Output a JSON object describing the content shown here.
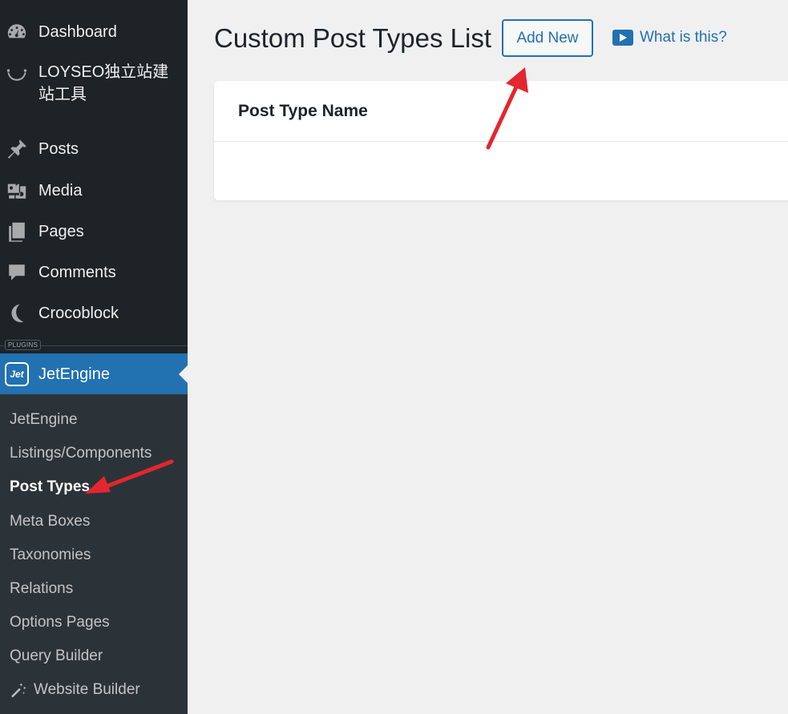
{
  "sidebar": {
    "menu": [
      {
        "label": "Dashboard",
        "icon": "dashboard-icon"
      },
      {
        "label": "LOYSEO独立站建站工具",
        "icon": "smile-icon"
      },
      {
        "label": "Posts",
        "icon": "pin-icon"
      },
      {
        "label": "Media",
        "icon": "media-icon"
      },
      {
        "label": "Pages",
        "icon": "pages-icon"
      },
      {
        "label": "Comments",
        "icon": "comments-icon"
      },
      {
        "label": "Crocoblock",
        "icon": "crocoblock-icon"
      }
    ],
    "plugins_label": "PLUGINS",
    "jetengine": {
      "label": "JetEngine",
      "logo_text": "Jet"
    },
    "submenu": [
      {
        "label": "JetEngine"
      },
      {
        "label": "Listings/Components"
      },
      {
        "label": "Post Types",
        "active": true
      },
      {
        "label": "Meta Boxes"
      },
      {
        "label": "Taxonomies"
      },
      {
        "label": "Relations"
      },
      {
        "label": "Options Pages"
      },
      {
        "label": "Query Builder"
      },
      {
        "label": "Website Builder",
        "icon": "magic-wand-icon"
      }
    ]
  },
  "main": {
    "title": "Custom Post Types List",
    "add_new_label": "Add New",
    "what_is_label": "What is this?",
    "table": {
      "columns": [
        "Post Type Name"
      ],
      "rows": []
    }
  },
  "colors": {
    "sidebar_bg": "#1d2327",
    "submenu_bg": "#2c3338",
    "accent": "#2271b1",
    "annotation_arrow": "#e3262f",
    "page_bg": "#f0f0f1"
  }
}
